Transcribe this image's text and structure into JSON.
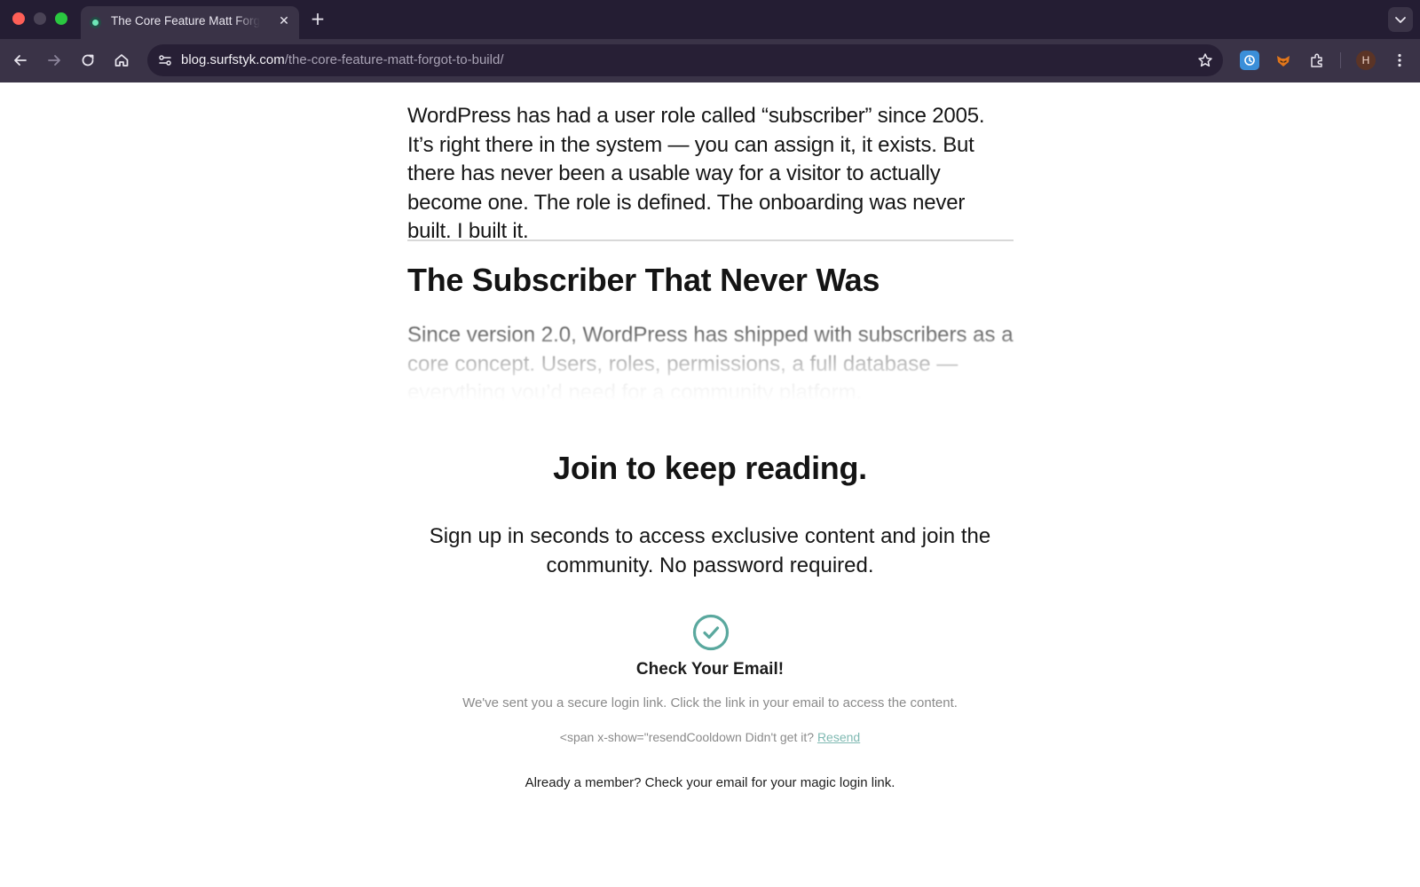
{
  "browser": {
    "tab": {
      "title": "The Core Feature Matt Forgot to Build"
    },
    "toolbar": {
      "url_host": "blog.surfstyk.com",
      "url_path": "/the-core-feature-matt-forgot-to-build/",
      "profile_initial": "H"
    },
    "colors": {
      "frame": "#241d33",
      "toolbar": "#3a3347",
      "omnibox": "#271f35"
    },
    "icons": [
      "back-icon",
      "forward-icon",
      "reload-icon",
      "home-icon",
      "site-settings-icon",
      "bookmark-star-icon",
      "extension-1-icon",
      "extension-2-icon",
      "extensions-puzzle-icon",
      "menu-kebab-icon"
    ]
  },
  "article": {
    "intro": "WordPress has had a user role called “subscriber” since 2005. It’s right there in the system — you can assign it, it exists. But there has never been a usable way for a visitor to actually become one. The role is defined. The onboarding was never built. I built it.",
    "section_heading": "The Subscriber That Never Was",
    "teaser": "Since version 2.0, WordPress has shipped with subscribers as a core concept. Users, roles, permissions, a full database — everything you’d need for a community platform."
  },
  "paywall": {
    "heading": "Join to keep reading.",
    "subheading": "Sign up in seconds to access exclusive content and join the community. No password required.",
    "check_title": "Check Your Email!",
    "check_body": "We've sent you a secure login link. Click the link in your email to access the content.",
    "resend_prefix": "<span x-show=\"resendCooldown Didn't get it?",
    "resend_link": "Resend",
    "member_note": "Already a member? Check your email for your magic login link.",
    "accent_color": "#5aa89e"
  }
}
